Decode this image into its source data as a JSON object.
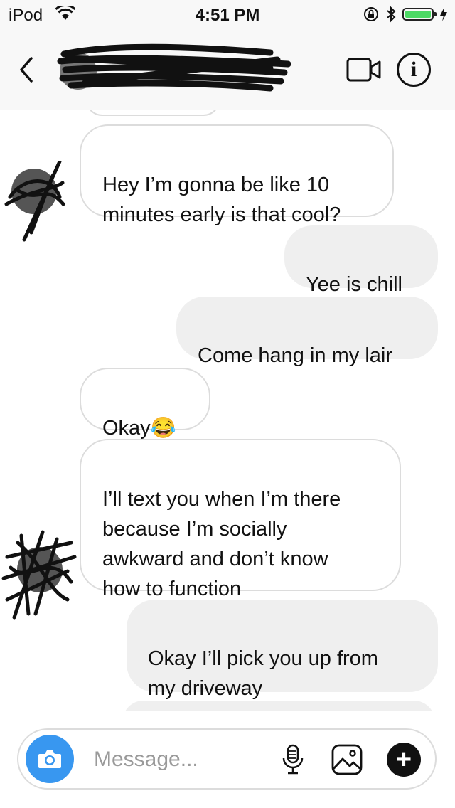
{
  "status_bar": {
    "carrier": "iPod",
    "time": "4:51 PM"
  },
  "header": {
    "icons": [
      "back-chevron-icon",
      "video-call-icon",
      "info-icon"
    ],
    "info_glyph": "i"
  },
  "messages": [
    {
      "direction": "incoming",
      "text": "Hey I’m gonna be like 10\nminutes early is that cool?"
    },
    {
      "direction": "outgoing",
      "text": "Yee is chill"
    },
    {
      "direction": "outgoing",
      "text": "Come hang in my lair"
    },
    {
      "direction": "incoming",
      "text": "Okay",
      "emoji": "😂"
    },
    {
      "direction": "incoming",
      "text": "I’ll text you when I’m there\nbecause I’m socially\nawkward and don’t know\nhow to function"
    },
    {
      "direction": "outgoing",
      "text": "Okay I’ll pick you up from\nmy driveway"
    }
  ],
  "composer": {
    "placeholder": "Message...",
    "icons": [
      "camera-icon",
      "microphone-icon",
      "gallery-icon",
      "plus-icon"
    ],
    "plus_glyph": "+"
  },
  "colors": {
    "accent": "#3897f0",
    "battery": "#4cd964",
    "outgoing_bubble": "#efefef"
  }
}
